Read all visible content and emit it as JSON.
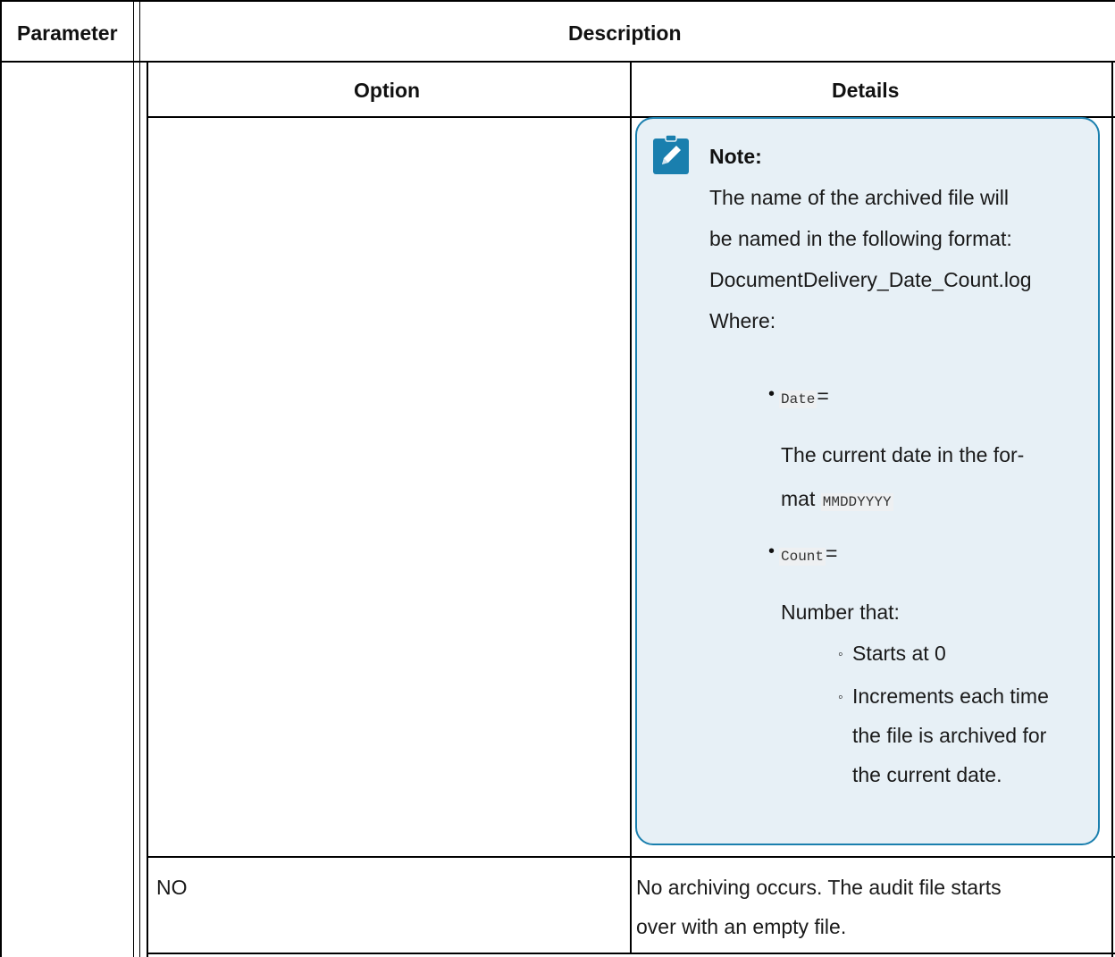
{
  "outer_table": {
    "headers": {
      "parameter": "Parameter",
      "description": "Description"
    }
  },
  "inner_table": {
    "headers": {
      "option": "Option",
      "details": "Details"
    },
    "note": {
      "title": "Note:",
      "lines": [
        "The name of the archived file will",
        "be named in the following format:",
        "DocumentDelivery_Date_Count.log",
        "Where:"
      ],
      "items": [
        {
          "code": "Date",
          "suffix": "=",
          "desc_line1": "The current date in the for-",
          "desc_line2_text": "mat ",
          "desc_line2_code": "MMDDYYYY"
        },
        {
          "code": "Count",
          "suffix": "=",
          "desc_line1": "Number that:",
          "subitems": [
            "Starts at 0",
            "Increments each time",
            "the file is archived for",
            "the current date."
          ]
        }
      ],
      "accent_color": "#1a7fae",
      "background_color": "#e7f0f6"
    },
    "rows": [
      {
        "option": "NO",
        "details_line1": "No archiving occurs. The audit file starts",
        "details_line2": "over with an empty file."
      }
    ]
  },
  "icons": {
    "note": "pencil-clipboard-icon"
  }
}
